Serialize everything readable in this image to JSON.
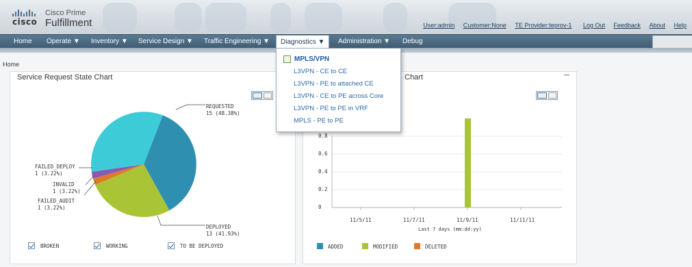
{
  "header": {
    "brand": "cisco",
    "product_line1": "Cisco Prime",
    "product_line2": "Fulfillment",
    "links": [
      "User:admin",
      "Customer:None",
      "TE Provider:teprov-1",
      "Log Out",
      "Feedback",
      "About",
      "Help"
    ]
  },
  "nav": {
    "items": [
      "Home",
      "Operate ▼",
      "Inventory ▼",
      "Service Design ▼",
      "Traffic Engineering ▼",
      "Diagnostics ▼",
      "Administration ▼",
      "Debug"
    ],
    "active_index": 5
  },
  "breadcrumb": "Home",
  "dropdown": {
    "header": "MPLS/VPN",
    "items": [
      "L3VPN - CE to CE",
      "L3VPN - PE to attached CE",
      "L3VPN - CE to PE across Core",
      "L3VPN - PE to PE in VRF",
      "MPLS - PE to PE"
    ]
  },
  "left_panel": {
    "title": "Service Request State Chart",
    "chart_data": {
      "type": "pie",
      "slices": [
        {
          "label": "REQUESTED",
          "count": 15,
          "pct": "48.38%",
          "value_text": "15 (48.38%)",
          "color": "#2f8fb0"
        },
        {
          "label": "DEPLOYED",
          "count": 13,
          "pct": "41.93%",
          "value_text": "13 (41.93%)",
          "color": "#a9c434"
        },
        {
          "label": "FAILED_AUDIT",
          "count": 1,
          "pct": "3.22%",
          "value_text": "1 (3.22%)",
          "color": "#e07a2a"
        },
        {
          "label": "INVALID",
          "count": 1,
          "pct": "3.22%",
          "value_text": "1 (3.22%)",
          "color": "#8a5ab0"
        },
        {
          "label": "FAILED_DEPLOY",
          "count": 1,
          "pct": "3.22%",
          "value_text": "1 (3.22%)",
          "color": "#3ecbd8"
        }
      ]
    },
    "checks": [
      "BROKEN",
      "WORKING",
      "TO BE DEPLOYED"
    ]
  },
  "right_panel": {
    "title_fragment": "Chart",
    "chart_data": {
      "type": "bar",
      "y_ticks": [
        "0.8",
        "0.6",
        "0.4",
        "0.2",
        "0"
      ],
      "x_ticks": [
        "11/5/11",
        "11/7/11",
        "11/9/11",
        "11/11/11"
      ],
      "xlabel": "Last 7 days (mm:dd:yy)",
      "ylim": [
        0,
        1
      ],
      "series": [
        {
          "name": "ADDED",
          "color": "#2f8fb0"
        },
        {
          "name": "MODIFIED",
          "color": "#a9c434",
          "bars": [
            {
              "x": "11/9/11",
              "value": 1
            }
          ]
        },
        {
          "name": "DELETED",
          "color": "#e07a2a"
        }
      ]
    }
  }
}
